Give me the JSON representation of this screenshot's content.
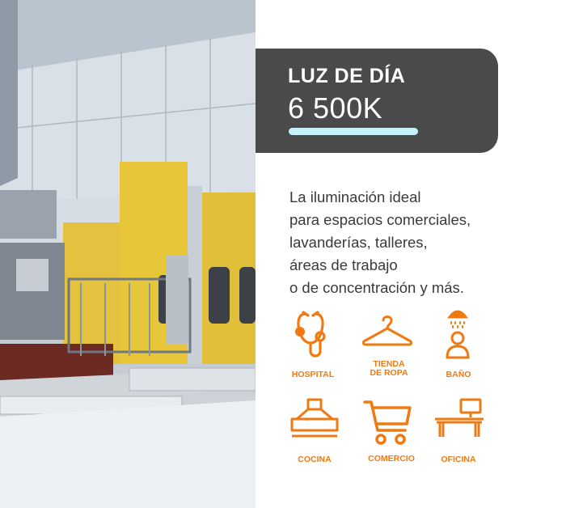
{
  "badge": {
    "title": "LUZ DE DÍA",
    "value": "6 500K",
    "bar_color": "#c8f2fb",
    "background": "#4a4a4a"
  },
  "description": {
    "lines": [
      "La iluminación ideal",
      "para espacios comerciales,",
      "lavanderías, talleres,",
      "áreas de trabajo",
      "o de concentración y más."
    ]
  },
  "accent_color": "#f07a12",
  "uses": [
    {
      "icon": "stethoscope-icon",
      "label_lines": [
        "HOSPITAL"
      ]
    },
    {
      "icon": "hanger-icon",
      "label_lines": [
        "TIENDA",
        "DE ROPA"
      ]
    },
    {
      "icon": "shower-icon",
      "label_lines": [
        "BAÑO"
      ]
    },
    {
      "icon": "kitchen-hood-icon",
      "label_lines": [
        "COCINA"
      ]
    },
    {
      "icon": "shopping-cart-icon",
      "label_lines": [
        "COMERCIO"
      ]
    },
    {
      "icon": "desk-computer-icon",
      "label_lines": [
        "OFICINA"
      ]
    }
  ]
}
